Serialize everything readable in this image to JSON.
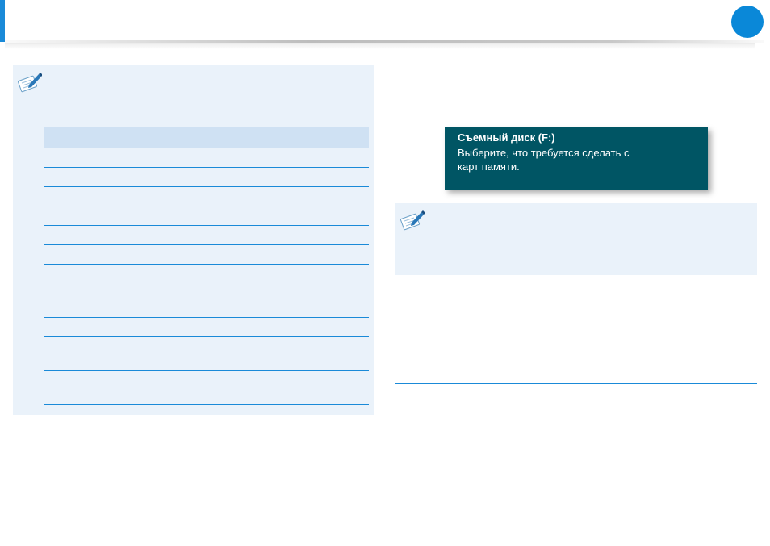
{
  "toast": {
    "title": "Съемный диск (F:)",
    "message": "Выберите, что требуется сделать с карт памяти."
  },
  "colors": {
    "accent": "#1a8ad8",
    "note_background": "#eaf2fa",
    "table_header": "#cfe1f3",
    "toast_background": "#005564"
  },
  "icons": {
    "note": "note-pencil-icon",
    "page_marker": "circle-badge"
  },
  "table": {
    "header": [
      "",
      ""
    ],
    "rows": [
      [
        "",
        ""
      ],
      [
        "",
        ""
      ],
      [
        "",
        ""
      ],
      [
        "",
        ""
      ],
      [
        "",
        ""
      ],
      [
        "",
        ""
      ],
      [
        "",
        ""
      ],
      [
        "",
        ""
      ],
      [
        "",
        ""
      ],
      [
        "",
        ""
      ],
      [
        "",
        ""
      ]
    ]
  }
}
